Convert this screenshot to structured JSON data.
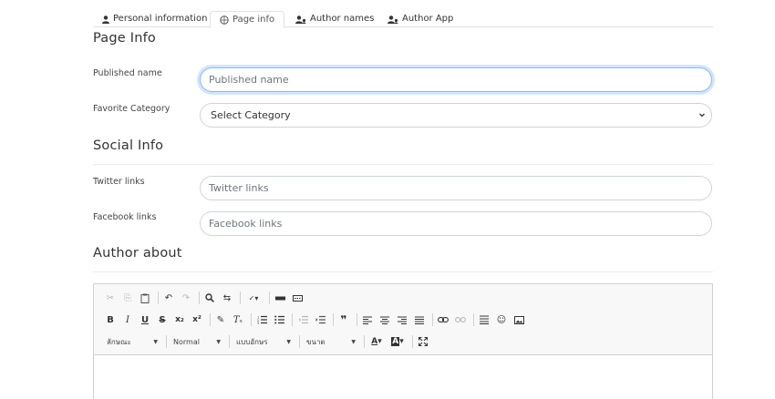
{
  "tabs": [
    {
      "label": "Personal information",
      "icon": "user-icon"
    },
    {
      "label": "Page info",
      "icon": "compass-icon",
      "active": true
    },
    {
      "label": "Author names",
      "icon": "users-icon"
    },
    {
      "label": "Author App",
      "icon": "users-icon"
    }
  ],
  "page_info": {
    "title": "Page Info",
    "published_name_label": "Published name",
    "published_name_placeholder": "Published name",
    "favorite_category_label": "Favorite Category",
    "favorite_category_value": "Select Category"
  },
  "social_info": {
    "title": "Social Info",
    "twitter_label": "Twitter links",
    "twitter_placeholder": "Twitter links",
    "facebook_label": "Facebook links",
    "facebook_placeholder": "Facebook links"
  },
  "author_about": {
    "title": "Author about"
  },
  "editor": {
    "styles_combo": "ลักษณะ",
    "format_combo": "Normal",
    "font_combo": "แบบอักษร",
    "size_combo": "ขนาด",
    "colors": {
      "accent": "#86b7fe",
      "toolbar_bg": "#f8f8f8",
      "border": "#d1d1d1"
    }
  }
}
